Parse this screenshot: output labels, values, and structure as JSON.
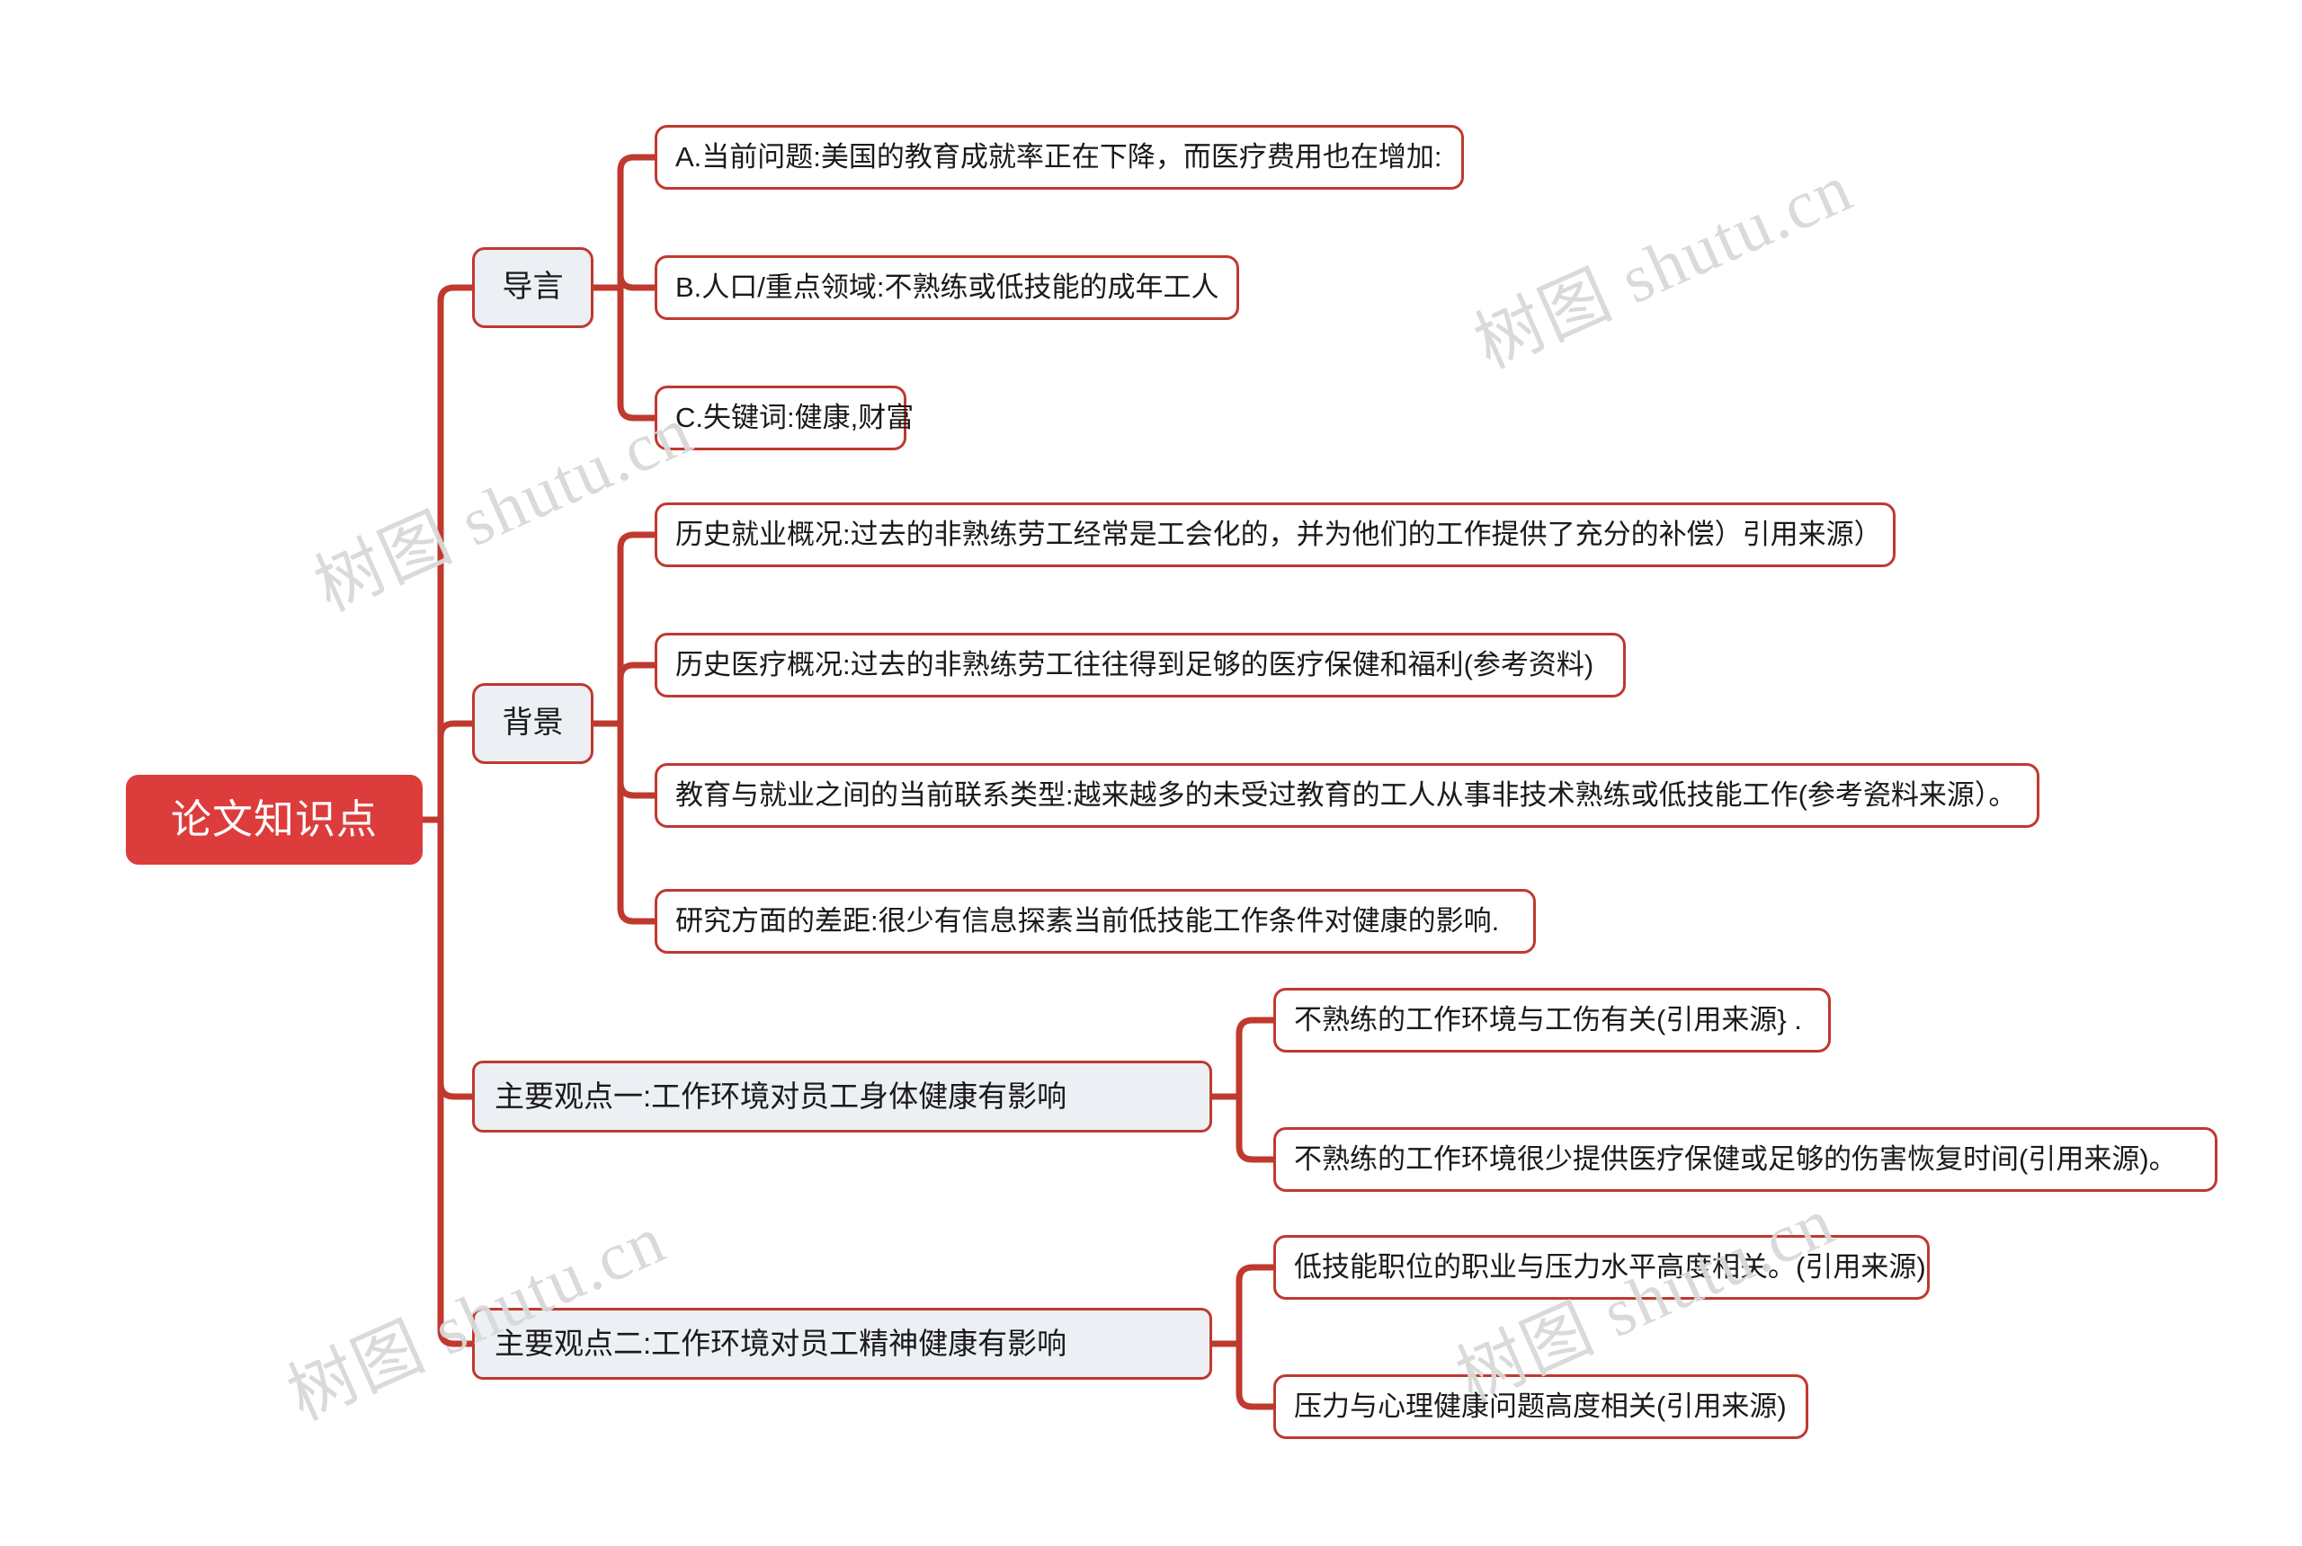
{
  "meta": {
    "watermark_text": "树图 shutu.cn",
    "colors": {
      "root_fill": "#DD3C3C",
      "node_border": "#C0392F",
      "branch_fill": "#eceff3",
      "leaf_fill": "#ffffff",
      "link": "#C0392F",
      "text": "#1a1a1a",
      "root_text": "#ffffff",
      "watermark": "#d9d9d9",
      "canvas": "#ffffff"
    }
  },
  "mindmap": {
    "type": "mindmap",
    "root": {
      "label": "论文知识点"
    },
    "branches": [
      {
        "label": "导言",
        "children": [
          {
            "label": "A.当前问题:美国的教育成就率正在下降，而医疗费用也在增加:"
          },
          {
            "label": "B.人口/重点领域:不熟练或低技能的成年工人"
          },
          {
            "label": "C.失键词:健康,财富"
          }
        ]
      },
      {
        "label": "背景",
        "children": [
          {
            "label": "历史就业概况:过去的非熟练劳工经常是工会化的，并为他们的工作提供了充分的补偿）引用来源）"
          },
          {
            "label": "历史医疗概况:过去的非熟练劳工往往得到足够的医疗保健和福利(参考资料)"
          },
          {
            "label": "教育与就业之间的当前联系类型:越来越多的未受过教育的工人从事非技术熟练或低技能工作(参考瓷料来源）。"
          },
          {
            "label": "研究方面的差距:很少有信息探素当前低技能工作条件对健康的影响."
          }
        ]
      },
      {
        "label": "主要观点一:工作环境对员工身体健康有影响",
        "children": [
          {
            "label": "不熟练的工作环境与工伤有关(引用来源} ."
          },
          {
            "label": "不熟练的工作环境很少提供医疗保健或足够的伤害恢复时间(引用来源)。"
          }
        ]
      },
      {
        "label": "主要观点二:工作环境对员工精神健康有影响",
        "children": [
          {
            "label": "低技能职位的职业与压力水平高度相关。(引用来源)"
          },
          {
            "label": "压力与心理健康问题高度相关(引用来源)"
          }
        ]
      }
    ]
  }
}
